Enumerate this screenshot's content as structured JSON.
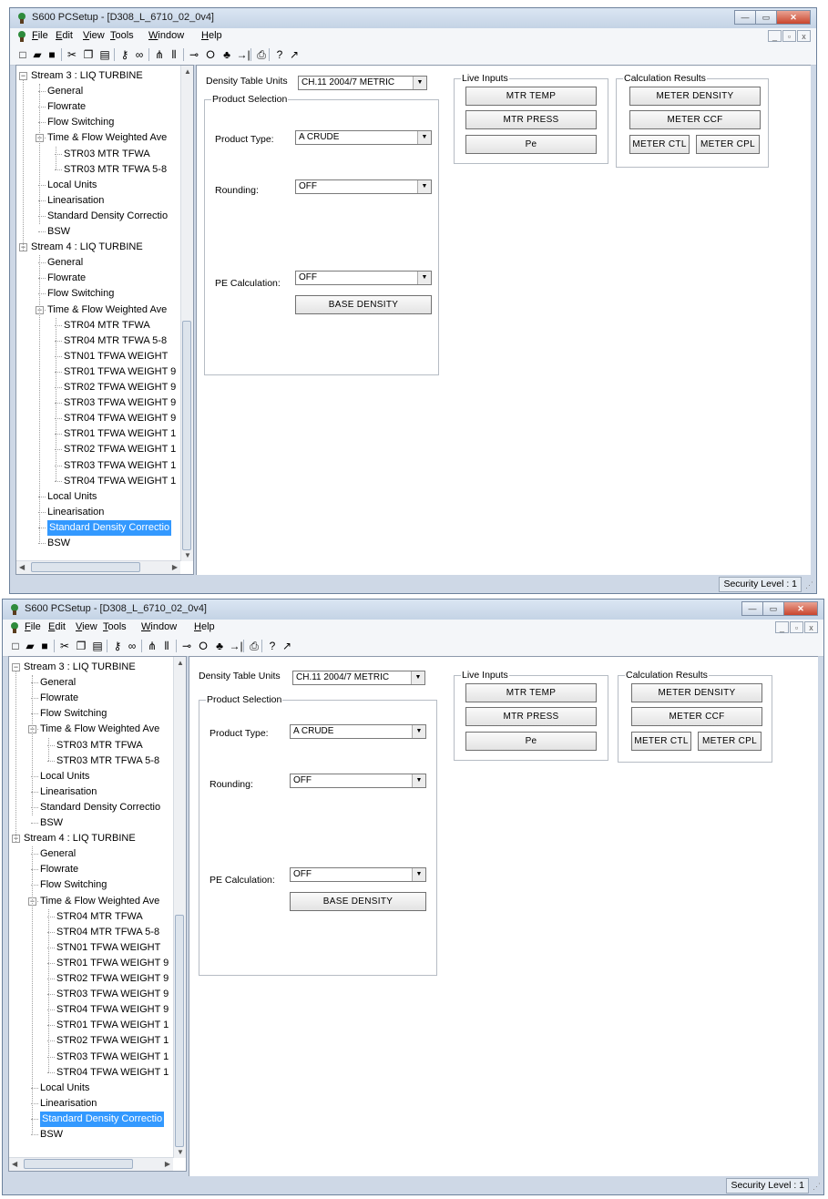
{
  "app": {
    "title": "S600 PCSetup  - [D308_L_6710_02_0v4]",
    "caption_buttons": [
      "minimize",
      "maximize",
      "close"
    ]
  },
  "menu": [
    {
      "accel": "F",
      "rest": "ile"
    },
    {
      "accel": "E",
      "rest": "dit"
    },
    {
      "accel": "V",
      "rest": "iew"
    },
    {
      "accel": "T",
      "rest": "ools"
    },
    {
      "accel": "W",
      "rest": "indow"
    },
    {
      "accel": "H",
      "rest": "elp"
    }
  ],
  "mdi_buttons": [
    "_",
    "ð",
    "x"
  ],
  "toolbar": [
    "new-file-icon",
    "open-folder-icon",
    "save-icon",
    "cut-icon",
    "copy-icon",
    "paste-icon",
    "key-icon",
    "binoculars-icon",
    "network-icon",
    "columns-icon",
    "disconnect-icon",
    "stop-circle-icon",
    "tree-icon",
    "connect-arrow-icon",
    "print-icon",
    "help-icon",
    "context-help-icon"
  ],
  "tree": [
    {
      "label": "Stream 3 : LIQ TURBINE",
      "level": 0,
      "expander": "−"
    },
    {
      "label": "General",
      "level": 1
    },
    {
      "label": "Flowrate",
      "level": 1
    },
    {
      "label": "Flow Switching",
      "level": 1
    },
    {
      "label": "Time & Flow Weighted Ave",
      "level": 1,
      "expander": "−"
    },
    {
      "label": "STR03 MTR TFWA",
      "level": 2
    },
    {
      "label": "STR03 MTR TFWA 5-8",
      "level": 2
    },
    {
      "label": "Local Units",
      "level": 1
    },
    {
      "label": "Linearisation",
      "level": 1
    },
    {
      "label": "Standard Density Correctio",
      "level": 1
    },
    {
      "label": "BSW",
      "level": 1
    },
    {
      "label": "Stream 4 : LIQ TURBINE",
      "level": 0,
      "expander": "−"
    },
    {
      "label": "General",
      "level": 1
    },
    {
      "label": "Flowrate",
      "level": 1
    },
    {
      "label": "Flow Switching",
      "level": 1
    },
    {
      "label": "Time & Flow Weighted Ave",
      "level": 1,
      "expander": "−"
    },
    {
      "label": "STR04 MTR TFWA",
      "level": 2
    },
    {
      "label": "STR04 MTR TFWA 5-8",
      "level": 2
    },
    {
      "label": "STN01 TFWA WEIGHT",
      "level": 2
    },
    {
      "label": "STR01 TFWA WEIGHT 9",
      "level": 2
    },
    {
      "label": "STR02 TFWA WEIGHT 9",
      "level": 2
    },
    {
      "label": "STR03 TFWA WEIGHT 9",
      "level": 2
    },
    {
      "label": "STR04 TFWA WEIGHT 9",
      "level": 2
    },
    {
      "label": "STR01 TFWA WEIGHT 1",
      "level": 2
    },
    {
      "label": "STR02 TFWA WEIGHT 1",
      "level": 2
    },
    {
      "label": "STR03 TFWA WEIGHT 1",
      "level": 2
    },
    {
      "label": "STR04 TFWA WEIGHT 1",
      "level": 2
    },
    {
      "label": "Local Units",
      "level": 1
    },
    {
      "label": "Linearisation",
      "level": 1
    },
    {
      "label": "Standard Density Correctio",
      "level": 1,
      "selected": true
    },
    {
      "label": "BSW",
      "level": 1
    }
  ],
  "form": {
    "density_table_units_label": "Density Table Units",
    "density_table_units_value": "CH.11 2004/7 METRIC",
    "product_selection_label": "Product Selection",
    "product_type_label": "Product Type:",
    "product_type_value": "A CRUDE",
    "rounding_label": "Rounding:",
    "rounding_value": "OFF",
    "pe_calculation_label": "PE Calculation:",
    "pe_calculation_value": "OFF",
    "base_density_button": "BASE DENSITY",
    "live_inputs_label": "Live Inputs",
    "mtr_temp_button": "MTR TEMP",
    "mtr_press_button": "MTR PRESS",
    "pe_button": "Pe",
    "calc_results_label": "Calculation Results",
    "meter_density_button": "METER DENSITY",
    "meter_ccf_button": "METER CCF",
    "meter_ctl_button": "METER CTL",
    "meter_cpl_button": "METER CPL"
  },
  "status": {
    "security_level": "Security Level : 1"
  },
  "colors": {
    "frame": "#ced8e6",
    "selection": "#3399ff",
    "close_button": "#c9452d"
  }
}
